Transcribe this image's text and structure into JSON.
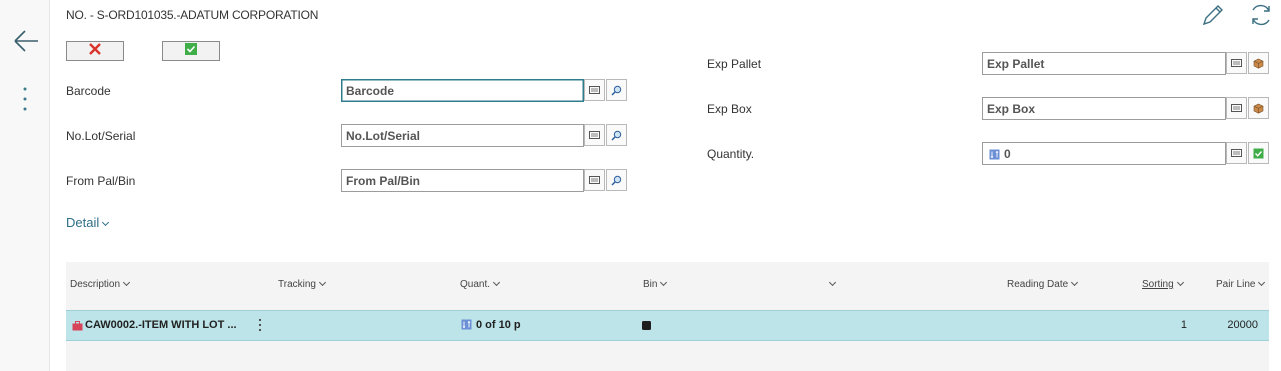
{
  "caption": "NO. - S-ORD101035.-ADATUM CORPORATION",
  "icons": {
    "back": "arrow-left-icon",
    "more": "vertical-dots-icon",
    "edit": "pencil-icon",
    "refresh": "refresh-icon",
    "cancel": "red-x-icon",
    "confirm": "green-check-icon"
  },
  "left_fields": [
    {
      "label": "Barcode",
      "placeholder": "Barcode",
      "value": ""
    },
    {
      "label": "No.Lot/Serial",
      "placeholder": "No.Lot/Serial",
      "value": ""
    },
    {
      "label": "From Pal/Bin",
      "placeholder": "From Pal/Bin",
      "value": ""
    }
  ],
  "right_fields": [
    {
      "label": "Exp Pallet",
      "placeholder": "Exp Pallet",
      "value": ""
    },
    {
      "label": "Exp Box",
      "placeholder": "Exp Box",
      "value": ""
    },
    {
      "label": "Quantity.",
      "value": "0"
    }
  ],
  "detail_label": "Detail",
  "grid": {
    "columns": [
      "Description",
      "Tracking",
      "Quant.",
      "Bin",
      "",
      "Reading Date",
      "Sorting",
      "Pair Line"
    ],
    "rows": [
      {
        "description": "CAW0002.-ITEM WITH LOT ...",
        "tracking": "",
        "quant": "0 of 10 p",
        "bin": "",
        "reading_date": "",
        "sorting": "1",
        "pair_line": "20000"
      }
    ]
  },
  "colors": {
    "accent": "#2f6f86",
    "row_selected": "#bde5e9",
    "cancel": "#d9342b",
    "confirm": "#3fae49"
  }
}
